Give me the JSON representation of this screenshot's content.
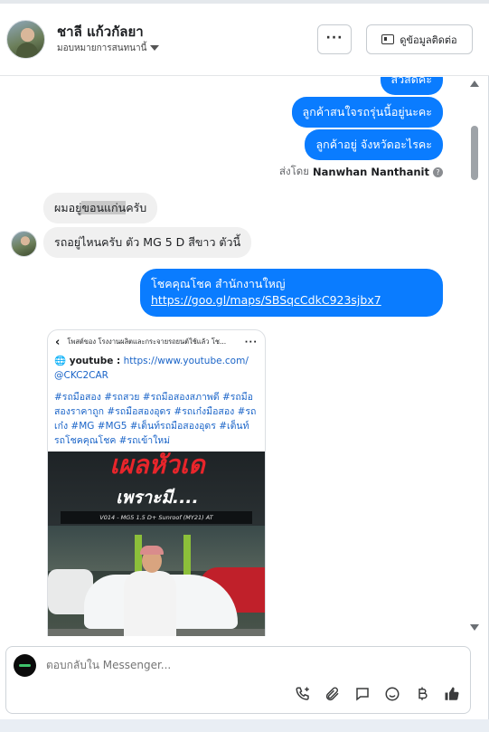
{
  "header": {
    "contact_name": "ชาลี แก้วกัลยา",
    "assign_label": "มอบหมายการสนทนานี้",
    "more_label": "···",
    "contact_button_label": "ดูข้อมูลติดต่อ"
  },
  "messages": {
    "out_1": "สวัสดีค่ะ",
    "out_2": "ลูกค้าสนใจรถรุ่นนี้อยู่นะคะ",
    "out_3": "ลูกค้าอยู่ จังหวัดอะไรคะ",
    "sent_by_prefix": "ส่งโดย",
    "sent_by_name": "Nanwhan Nanthanit",
    "help_mark": "?",
    "in_1_before": "ผมอยู่",
    "in_1_highlight": "ขอนแก่น",
    "in_1_after": "ครับ",
    "in_2": "รถอยู่ไหนครับ ตัว MG 5 D สีขาว ตัวนี้",
    "link_title": "โชคคุณโชค สำนักงานใหญ่",
    "link_url": "https://goo.gl/maps/SBSqcCdkC923sjbx7"
  },
  "post_card": {
    "back_label": "‹",
    "top_title": "โพสต์ของ โรงงานผลิตและกระจายรถยนต์ใช้แล้ว โช...",
    "dots": "···",
    "youtube_label": "youtube :",
    "youtube_url": "https://www.youtube.com/",
    "youtube_handle": "@CKC2CAR",
    "hashtags": "#รถมือสอง #รถสวย #รถมือสองสภาพดี #รถมือสองราคาถูก #รถมือสองอุดร #รถเก๋งมือสอง #รถเก๋ง #MG #MG5 #เต็นท์รถมือสองอุดร #เต็นท์รถโชคคุณโชค #รถเข้าใหม่",
    "image_headline": "เผลหัวเด",
    "image_subline": "เพราะมี....",
    "image_strip": "V014 - MG5 1.5 D+ Sunroof (MY21) AT"
  },
  "composer": {
    "placeholder": "ตอบกลับใน Messenger..."
  },
  "icons": {
    "call": "phone-plus-icon",
    "attach": "paperclip-icon",
    "saved_replies": "chat-bubble-icon",
    "emoji": "smiley-icon",
    "payment": "baht-icon",
    "like": "thumbs-up-icon"
  },
  "colors": {
    "outgoing_bubble": "#0a7cff",
    "incoming_bubble": "#f0f0f0"
  }
}
